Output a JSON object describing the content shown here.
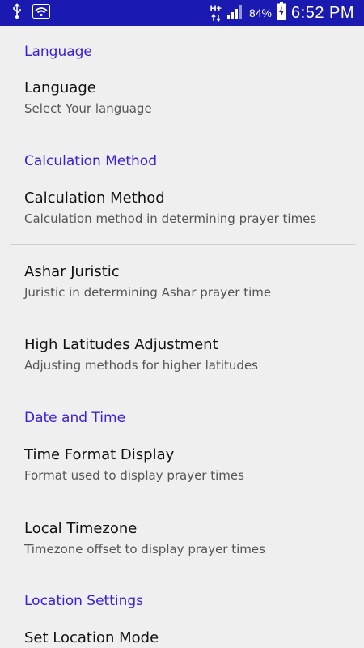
{
  "status_bar": {
    "network_type": "H+",
    "battery_percent": "84%",
    "time": "6:52 PM",
    "icons": [
      "usb-icon",
      "wifi-icon",
      "data-arrows-icon",
      "signal-icon",
      "battery-charging-icon"
    ]
  },
  "sections": [
    {
      "category": "Language",
      "items": [
        {
          "title": "Language",
          "summary": "Select Your language"
        }
      ]
    },
    {
      "category": "Calculation Method",
      "items": [
        {
          "title": "Calculation Method",
          "summary": "Calculation method in determining prayer times"
        },
        {
          "title": "Ashar Juristic",
          "summary": "Juristic in determining Ashar prayer time"
        },
        {
          "title": "High Latitudes Adjustment",
          "summary": "Adjusting methods for higher latitudes"
        }
      ]
    },
    {
      "category": "Date and Time",
      "items": [
        {
          "title": "Time Format Display",
          "summary": "Format used to display prayer times"
        },
        {
          "title": "Local Timezone",
          "summary": "Timezone offset to display prayer times"
        }
      ]
    },
    {
      "category": "Location Settings",
      "items": [
        {
          "title": "Set Location Mode",
          "summary": ""
        }
      ]
    }
  ],
  "colors": {
    "status_bar": "#1a1ab0",
    "category_text": "#3b1ed6",
    "background": "#efefef"
  }
}
